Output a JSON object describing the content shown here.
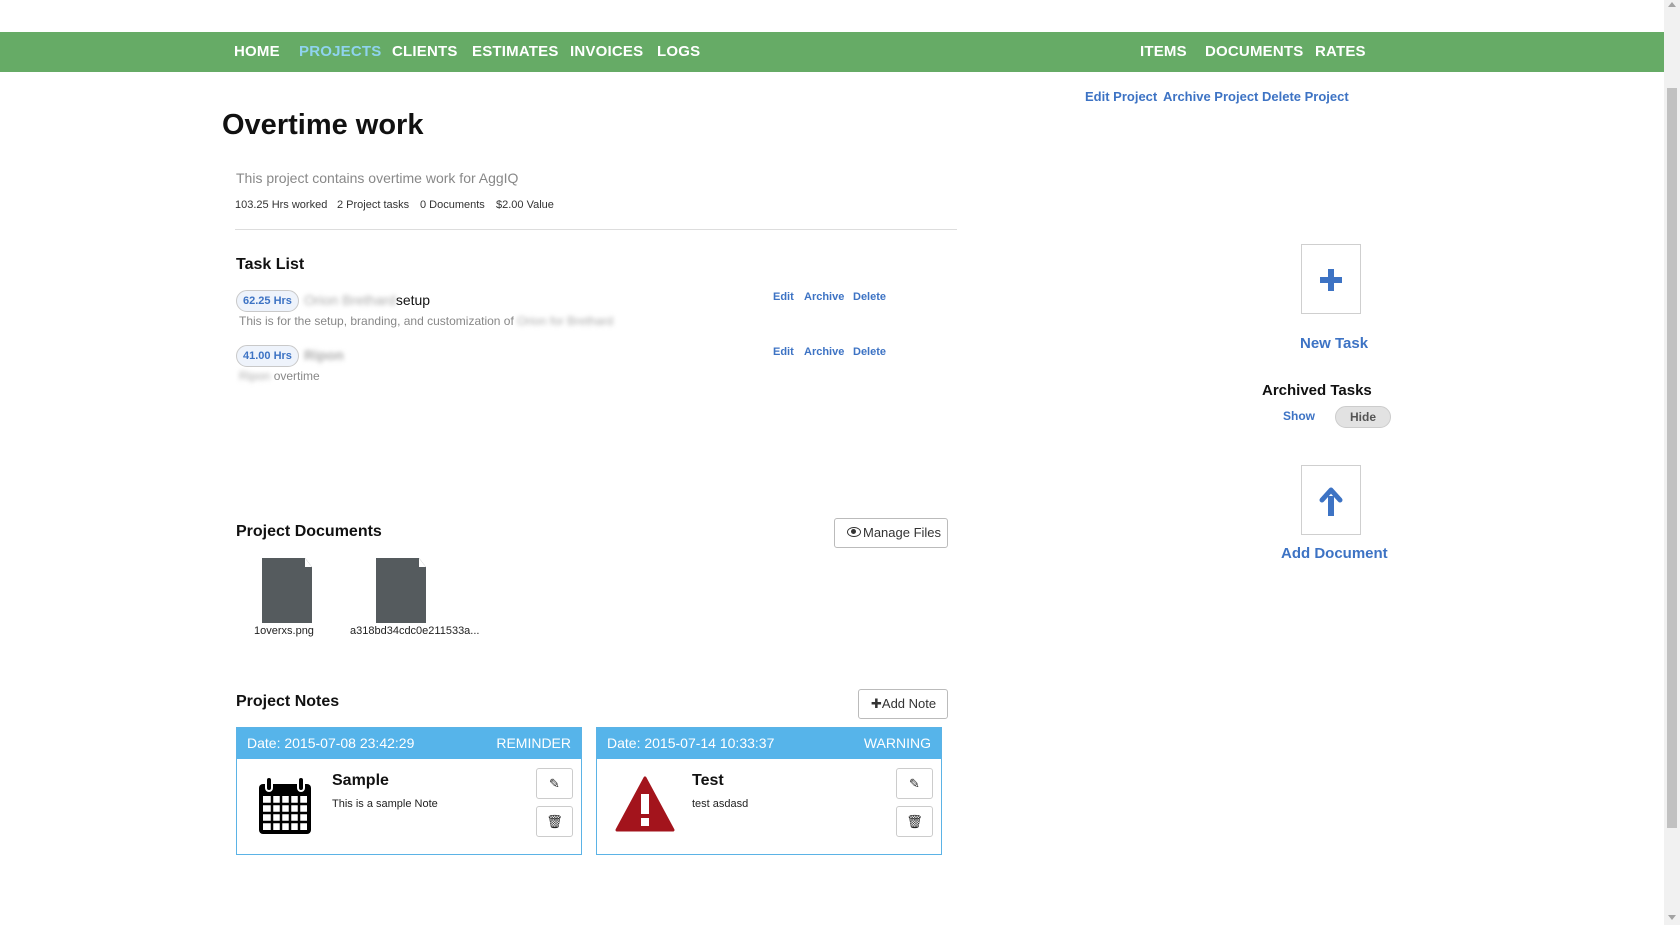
{
  "nav": {
    "left": [
      "HOME",
      "PROJECTS",
      "CLIENTS",
      "ESTIMATES",
      "INVOICES",
      "LOGS"
    ],
    "right": [
      "ITEMS",
      "DOCUMENTS",
      "RATES"
    ],
    "active": "PROJECTS"
  },
  "project_actions": [
    "Edit Project",
    "Archive Project",
    "Delete Project"
  ],
  "project": {
    "title": "Overtime work",
    "description": "This project contains overtime work for AggIQ",
    "stats": {
      "hours": "103.25 Hrs worked",
      "tasks": "2 Project tasks",
      "documents": "0 Documents",
      "value": "$2.00 Value"
    }
  },
  "task_list": {
    "heading": "Task List",
    "items": [
      {
        "hours": "62.25 Hrs",
        "name_blurred": "Orion Brethard",
        "name_suffix": "setup",
        "desc": "This is for the setup, branding, and customization of ",
        "desc_blurred": "Orion for Brethard",
        "actions": [
          "Edit",
          "Archive",
          "Delete"
        ]
      },
      {
        "hours": "41.00 Hrs",
        "name_blurred": "Ripon",
        "name_suffix": "",
        "desc_prefix_blurred": "Ripon",
        "desc": " overtime",
        "actions": [
          "Edit",
          "Archive",
          "Delete"
        ]
      }
    ]
  },
  "documents": {
    "heading": "Project Documents",
    "manage_label": "Manage Files",
    "files": [
      "1overxs.png",
      "a318bd34cdc0e211533a..."
    ]
  },
  "notes": {
    "heading": "Project Notes",
    "add_label": "Add Note",
    "items": [
      {
        "date": "Date: 2015-07-08 23:42:29",
        "type": "REMINDER",
        "title": "Sample",
        "body": "This is a sample Note",
        "icon": "calendar-icon"
      },
      {
        "date": "Date: 2015-07-14 10:33:37",
        "type": "WARNING",
        "title": "Test",
        "body": "test asdasd",
        "icon": "warning-icon"
      }
    ]
  },
  "sidebar": {
    "new_task": "New Task",
    "archived_heading": "Archived Tasks",
    "show": "Show",
    "hide": "Hide",
    "add_document": "Add Document"
  },
  "colors": {
    "nav_bg": "#66ab66",
    "active_nav": "#8fd3ee",
    "link": "#3d73c4",
    "note_header": "#56b4ea",
    "warning": "#a3141c"
  }
}
